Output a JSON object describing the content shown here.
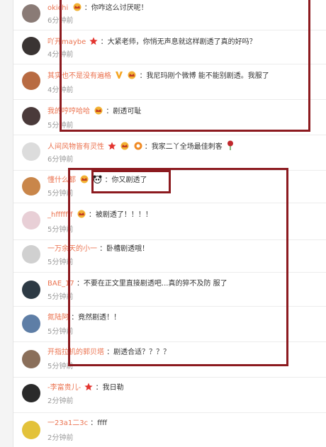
{
  "comments": [
    {
      "user": "okichi",
      "text": "：你咋这么讨厌呢！",
      "time": "6分钟前",
      "badges": [
        "vip-crown-icon"
      ],
      "avatar_color": "#8a7b76"
    },
    {
      "user": "吖开maybe",
      "text": "：大紧老师，你悄无声息就这样剧透了真的好吗？",
      "time": "4分钟前",
      "badges": [
        "star-icon"
      ],
      "avatar_color": "#3a3433"
    },
    {
      "user": "其实也不是没有遍格",
      "text": "：我尼玛刚个微博 能不能别剧透。我服了",
      "time": "4分钟前",
      "badges": [
        "v-verified-icon",
        "vip-crown-icon"
      ],
      "avatar_color": "#b86b42"
    },
    {
      "user": "我的哼哼哈哈",
      "text": "：剧透可耻",
      "time": "5分钟前",
      "badges": [
        "vip-crown-icon"
      ],
      "avatar_color": "#4a3a3a"
    },
    {
      "user": "人间风物皆有灵性",
      "text": "：我家二丫全场最佳刺客",
      "time": "6分钟前",
      "badges": [
        "star-icon",
        "vip-crown-icon",
        "medal-icon"
      ],
      "trailing_emoji": "rose-icon",
      "avatar_color": "#dcdcdc"
    },
    {
      "user": "懂什么都",
      "text": "：你又剧透了",
      "time": "5分钟前",
      "badges": [
        "vip-crown-icon",
        "panda-icon"
      ],
      "avatar_color": "#c9864a"
    },
    {
      "user": "_hfffffff",
      "text": "：被剧透了！！！！",
      "time": "5分钟前",
      "badges": [
        "vip-crown-icon"
      ],
      "avatar_color": "#e8cfd6"
    },
    {
      "user": "一万余天的小一",
      "text": "：卧槽剧透哦！",
      "time": "5分钟前",
      "badges": [],
      "avatar_color": "#d0d0d0"
    },
    {
      "user": "BAE_17",
      "text": "：不要在正文里直接剧透吧...真的猝不及防 服了",
      "time": "5分钟前",
      "badges": [],
      "avatar_color": "#2d3a44"
    },
    {
      "user": "氮陆阿",
      "text": "：竟然剧透！！",
      "time": "5分钟前",
      "badges": [],
      "avatar_color": "#5e7ea6"
    },
    {
      "user": "开指拉机的郭贝塔",
      "text": "：剧透合适？？？？",
      "time": "5分钟前",
      "badges": [],
      "avatar_color": "#8a6f5a"
    },
    {
      "user": "-李富贵儿-",
      "text": "：我日勒",
      "time": "2分钟前",
      "badges": [
        "star-icon"
      ],
      "avatar_color": "#2a2a2a"
    },
    {
      "user": "一23a1二3c",
      "text": "：ffff",
      "time": "2分钟前",
      "badges": [],
      "avatar_color": "#e3c23a"
    }
  ],
  "colors": {
    "username": "#eb7350",
    "annotation_box": "#8c1a1f"
  }
}
